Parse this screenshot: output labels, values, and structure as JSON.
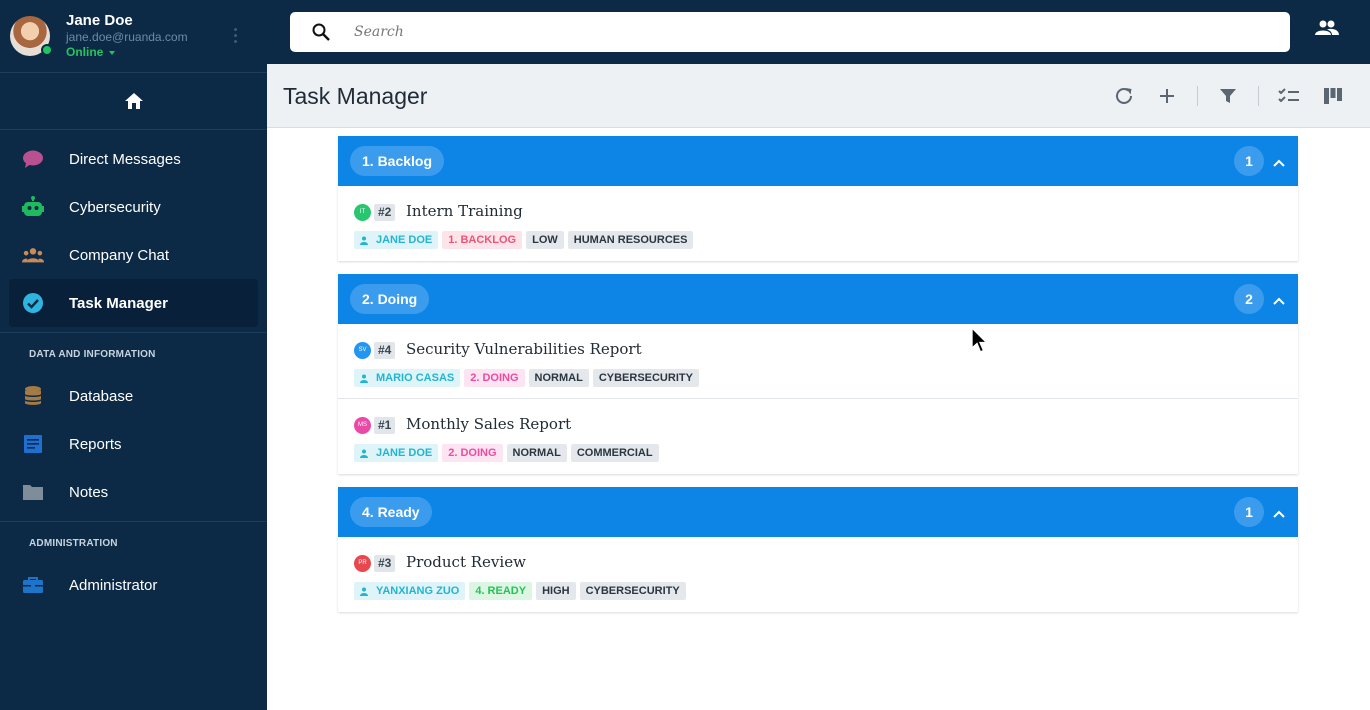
{
  "user": {
    "name": "Jane Doe",
    "email": "jane.doe@ruanda.com",
    "status": "Online"
  },
  "nav": {
    "main": [
      {
        "label": "Direct Messages",
        "icon": "chat-bubble-icon",
        "color": "#b9508f"
      },
      {
        "label": "Cybersecurity",
        "icon": "robot-icon",
        "color": "#21b95e"
      },
      {
        "label": "Company Chat",
        "icon": "group-icon",
        "color": "#c98a56"
      },
      {
        "label": "Task Manager",
        "icon": "check-circle-icon",
        "color": "#2fb4e0",
        "active": true
      }
    ],
    "data_section": "DATA AND INFORMATION",
    "data": [
      {
        "label": "Database",
        "icon": "database-icon",
        "color": "#a57a45"
      },
      {
        "label": "Reports",
        "icon": "document-icon",
        "color": "#1f6fd1"
      },
      {
        "label": "Notes",
        "icon": "folder-icon",
        "color": "#7f8c99"
      }
    ],
    "admin_section": "ADMINISTRATION",
    "admin": [
      {
        "label": "Administrator",
        "icon": "toolbox-icon",
        "color": "#1e74c8"
      }
    ]
  },
  "search": {
    "placeholder": "Search"
  },
  "header": {
    "title": "Task Manager"
  },
  "groups": [
    {
      "label": "1. Backlog",
      "count": "1",
      "tasks": [
        {
          "initials": "IT",
          "dot_color": "#28c76f",
          "id": "#2",
          "title": "Intern Training",
          "assignee": "JANE DOE",
          "status": "1. BACKLOG",
          "priority": "LOW",
          "category": "HUMAN RESOURCES"
        }
      ]
    },
    {
      "label": "2. Doing",
      "count": "2",
      "tasks": [
        {
          "initials": "SV",
          "dot_color": "#2196f3",
          "id": "#4",
          "title": "Security Vulnerabilities Report",
          "assignee": "MARIO CASAS",
          "status": "2. DOING",
          "priority": "NORMAL",
          "category": "CYBERSECURITY"
        },
        {
          "initials": "MS",
          "dot_color": "#e94aa8",
          "id": "#1",
          "title": "Monthly Sales Report",
          "assignee": "JANE DOE",
          "status": "2. DOING",
          "priority": "NORMAL",
          "category": "COMMERCIAL"
        }
      ]
    },
    {
      "label": "4. Ready",
      "count": "1",
      "tasks": [
        {
          "initials": "PR",
          "dot_color": "#e8474f",
          "id": "#3",
          "title": "Product Review",
          "assignee": "YANXIANG ZUO",
          "status": "4. READY",
          "priority": "HIGH",
          "category": "CYBERSECURITY"
        }
      ]
    }
  ],
  "colors": {
    "sidebar": "#0c2a45",
    "accent": "#0d85e6",
    "header_bg": "#eef1f4"
  }
}
